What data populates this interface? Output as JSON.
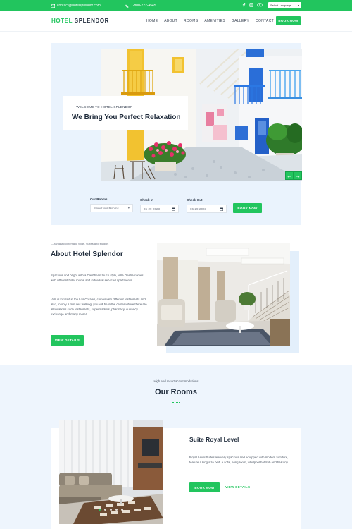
{
  "topbar": {
    "email": "contact@hotelsplendor.com",
    "phone": "1-800-222-4545",
    "socials": [
      "facebook-icon",
      "instagram-icon",
      "tripadvisor-icon"
    ],
    "language": "Select Language",
    "bg_color": "#22c55e"
  },
  "nav": {
    "logo_part1": "HOTEL",
    "logo_part2": "SPLENDOR",
    "items": [
      "HOME",
      "ABOUT",
      "ROOMS",
      "AMENITIES",
      "GALLERY",
      "CONTACT"
    ],
    "cta": "BOOK NOW"
  },
  "hero": {
    "kicker": "— WELCOME TO HOTEL SPLENDOR",
    "title": "We Bring You Perfect Relaxation",
    "prev": "←",
    "next": "→"
  },
  "booking": {
    "rooms_label": "Our Rooms",
    "rooms_placeholder": "Select our Rooms",
    "checkin_label": "Check In",
    "checkin_value": "06-29-2023",
    "checkout_label": "Check Out",
    "checkout_value": "06-29-2023",
    "button": "BOOK NOW"
  },
  "about": {
    "kicker": "— fantastic cinematic villas, suites and studios",
    "title": "About Hotel Splendor",
    "p1": "Spacious and bright with a Caribbean touch style, Villa Oestra comes with different hotel rooms and individual serviced apartments.",
    "p2": "Villa is located in the Los Corales, comes with different restaurants and also, in only 5 minutes walking, you will be in the center where there are all locations such restaurants, supermarkets, pharmacy, currency exchange and many more!",
    "button": "VIEW DETAILS"
  },
  "rooms": {
    "kicker": "High end resort accommodations",
    "title": "Our Rooms",
    "room": {
      "title": "Suite Royal Level",
      "description": "Royal Level Suites are very spacious and equipped with modern furniture, feature a king size bed, a sofa, living room, whirlpool bathtub and balcony.",
      "book": "BOOK NOW",
      "details": "VIEW DETAILS"
    },
    "carousel_dots": 5,
    "active_dot": 1
  },
  "colors": {
    "accent": "#22c55e",
    "heading": "#1e2a3a",
    "hero_bg": "#eaf3fd",
    "section_bg": "#eef5fd"
  }
}
